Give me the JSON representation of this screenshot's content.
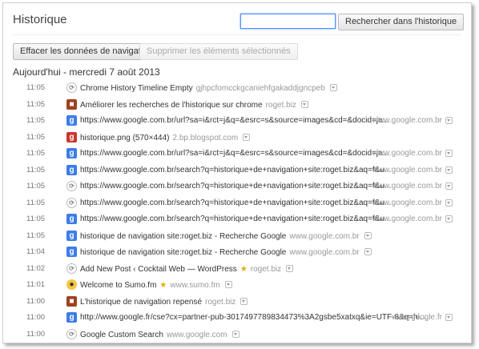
{
  "title": "Historique",
  "search": {
    "value": "",
    "button": "Rechercher dans l'historique"
  },
  "actions": {
    "clear": "Effacer les données de navigation...",
    "remove": "Supprimer les éléments sélectionnés"
  },
  "date_heading": "Aujourd'hui - mercredi 7 août 2013",
  "rows": [
    {
      "time": "11:05",
      "icon": "chrome-extension-icon",
      "title": "Chrome History Timeline Empty",
      "domain": "gjhpcfomcckgcaniehfgakaddjgncpeb"
    },
    {
      "time": "11:05",
      "icon": "site-favicon-icon",
      "title": "Améliorer les recherches de l'historique sur chrome",
      "domain": "roget.biz"
    },
    {
      "time": "11:05",
      "icon": "google-icon",
      "title": "https://www.google.com.br/url?sa=i&rct=j&q=&esrc=s&source=images&cd=&docid=ja...",
      "domain": "www.google.com.br"
    },
    {
      "time": "11:05",
      "icon": "image-icon",
      "title": "historique.png (570×444)",
      "domain": "2.bp.blogspot.com"
    },
    {
      "time": "11:05",
      "icon": "google-icon",
      "title": "https://www.google.com.br/url?sa=i&rct=j&q=&esrc=s&source=images&cd=&docid=ja...",
      "domain": "www.google.com.br"
    },
    {
      "time": "11:05",
      "icon": "google-icon",
      "title": "https://www.google.com.br/search?q=historique+de+navigation+site:roget.biz&aq=f&u...",
      "domain": "www.google.com.br"
    },
    {
      "time": "11:05",
      "icon": "chrome-extension-icon",
      "title": "https://www.google.com.br/search?q=historique+de+navigation+site:roget.biz&aq=f&u...",
      "domain": "www.google.com.br"
    },
    {
      "time": "11:05",
      "icon": "chrome-extension-icon",
      "title": "https://www.google.com.br/search?q=historique+de+navigation+site:roget.biz&aq=f&u...",
      "domain": "www.google.com.br"
    },
    {
      "time": "11:05",
      "icon": "google-icon",
      "title": "https://www.google.com.br/search?q=historique+de+navigation+site:roget.biz&aq=f&u...",
      "domain": "www.google.com.br"
    },
    {
      "time": "11:05",
      "icon": "google-icon",
      "title": "historique de navigation site:roget.biz - Recherche Google",
      "domain": "www.google.com.br"
    },
    {
      "time": "11:04",
      "icon": "google-icon",
      "title": "historique de navigation site:roget.biz - Recherche Google",
      "domain": "www.google.com.br"
    },
    {
      "time": "11:02",
      "icon": "chrome-extension-icon",
      "title": "Add New Post ‹ Cocktail Web — WordPress",
      "domain": "roget.biz",
      "star": true
    },
    {
      "time": "11:01",
      "icon": "sumo-icon",
      "title": "Welcome to Sumo.fm",
      "domain": "www.sumo.fm",
      "star": true
    },
    {
      "time": "11:00",
      "icon": "site-favicon-icon",
      "title": "L'historique de navigation repensé",
      "domain": "roget.biz"
    },
    {
      "time": "11:00",
      "icon": "google-icon",
      "title": "http://www.google.fr/cse?cx=partner-pub-3017497789834473%3A2gsbe5xatxq&ie=UTF-8&q=hi...",
      "domain": "www.google.fr"
    },
    {
      "time": "11:00",
      "icon": "chrome-extension-icon",
      "title": "Google Custom Search",
      "domain": "www.google.com"
    }
  ]
}
